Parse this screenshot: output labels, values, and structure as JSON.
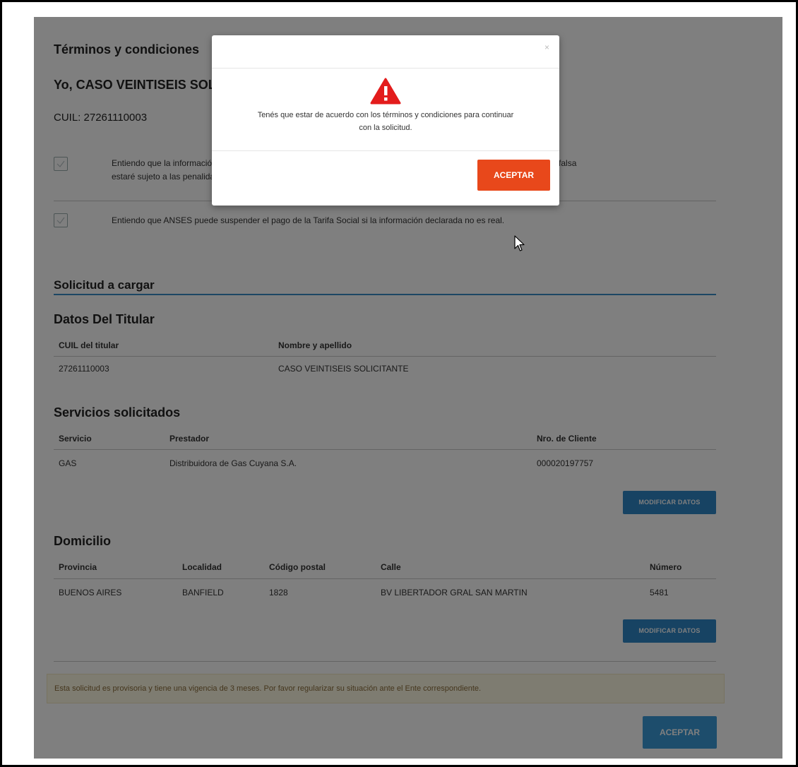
{
  "terms": {
    "title": "Términos y condiciones",
    "declarant": "Yo, CASO VEINTISEIS SOLICITANTE",
    "cuil": "CUIL: 27261110003",
    "items": [
      {
        "line1": "Entiendo que la información declarada tiene carácter de declaración jurada y que en caso de proporcionar información falsa",
        "line2": "estaré sujeto a las penalidades previstas en el Código Penal Argentino para los delitos de estafa y falsificación."
      },
      {
        "line1": "Entiendo que ANSES puede suspender el pago de la Tarifa Social si la información declarada no es real.",
        "line2": ""
      }
    ]
  },
  "solicitud": {
    "title": "Solicitud a cargar",
    "titular": {
      "title": "Datos Del Titular",
      "headers": [
        "CUIL del titular",
        "Nombre y apellido"
      ],
      "row": [
        "27261110003",
        "CASO VEINTISEIS SOLICITANTE"
      ]
    },
    "servicios": {
      "title": "Servicios solicitados",
      "headers": [
        "Servicio",
        "Prestador",
        "Nro. de Cliente"
      ],
      "row": [
        "GAS",
        "Distribuidora de Gas Cuyana S.A.",
        "000020197757"
      ],
      "button": "MODIFICAR DATOS"
    },
    "domicilio": {
      "title": "Domicilio",
      "headers": [
        "Provincia",
        "Localidad",
        "Código postal",
        "Calle",
        "Número"
      ],
      "row": [
        "BUENOS AIRES",
        "BANFIELD",
        "1828",
        "BV LIBERTADOR GRAL SAN MARTIN",
        "5481"
      ],
      "button": "MODIFICAR DATOS"
    },
    "notice": "Esta solicitud es provisoria y tiene una vigencia de 3 meses. Por favor regularizar su situación ante el Ente correspondiente.",
    "accept_button": "ACEPTAR"
  },
  "modal": {
    "close": "×",
    "icon": "warning-triangle-icon",
    "message_line1": "Tenés que estar de acuerdo con los términos y condiciones para continuar",
    "message_line2": "con la solicitud.",
    "accept_button": "ACEPTAR",
    "accent_color": "#e8481b",
    "icon_color": "#e31c1c"
  }
}
